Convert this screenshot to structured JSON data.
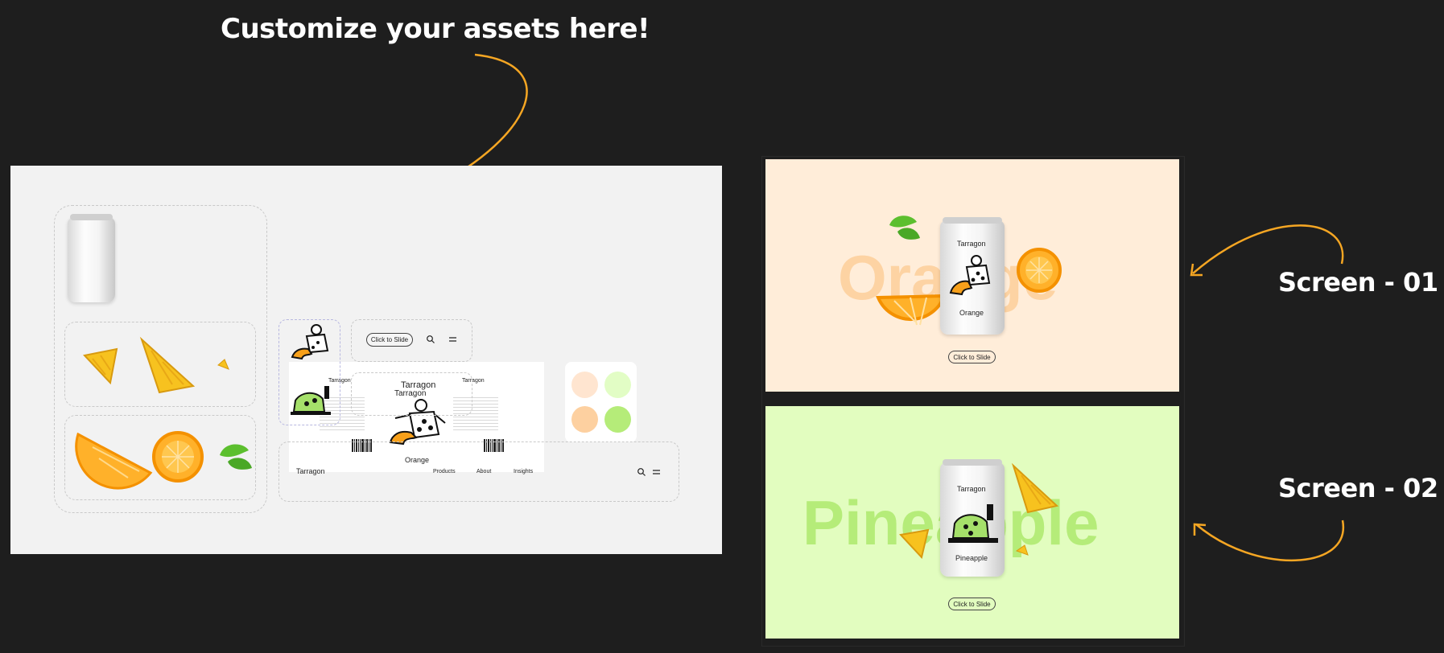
{
  "heading": "Customize your assets here!",
  "screen_labels": [
    "Screen - 01",
    "Screen - 02"
  ],
  "colors": {
    "background": "#1e1e1e",
    "accent_arrow": "#f5a623",
    "artboard": "#f2f2f2",
    "screen1_bg": "#ffedd9",
    "screen1_word": "#fdd3a3",
    "screen2_bg": "#e2fdbf",
    "screen2_word": "#b5ec79",
    "swatch_peach_light": "#ffe5d0",
    "swatch_green_light": "#e2fdc5",
    "swatch_peach": "#fdd0a0",
    "swatch_green": "#b5ec79"
  },
  "assets": {
    "brand": "Tarragon",
    "flavor": "Orange",
    "click_to_slide": "Click to Slide",
    "nav": {
      "logo": "Tarragon",
      "links": [
        "Products",
        "About",
        "Insights"
      ]
    },
    "icons": [
      "search-icon",
      "menu-icon",
      "leaf-icon",
      "pineapple-icon",
      "orange-icon"
    ]
  },
  "screen1": {
    "word": "Orange",
    "brand": "Tarragon",
    "flavor": "Orange",
    "button": "Click to Slide"
  },
  "screen2": {
    "word": "Pineapple",
    "brand": "Tarragon",
    "flavor": "Pineapple",
    "button": "Click to Slide"
  }
}
